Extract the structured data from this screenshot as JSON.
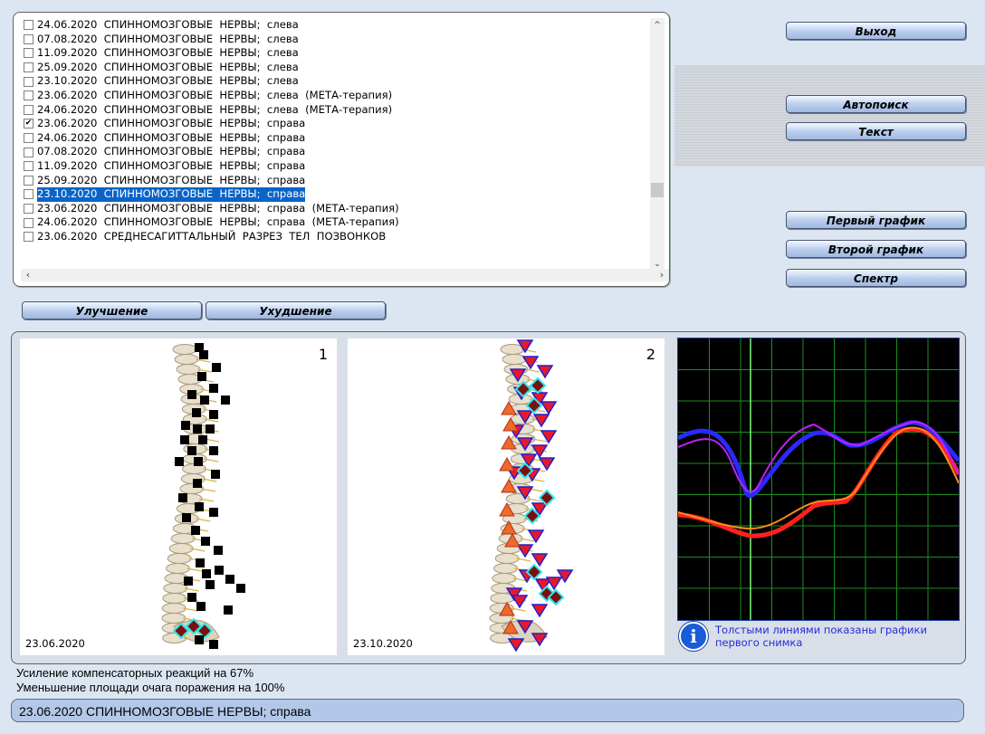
{
  "records": [
    {
      "checked": false,
      "text": "24.06.2020  СПИННОМОЗГОВЫЕ  НЕРВЫ;  слева"
    },
    {
      "checked": false,
      "text": "07.08.2020  СПИННОМОЗГОВЫЕ  НЕРВЫ;  слева"
    },
    {
      "checked": false,
      "text": "11.09.2020  СПИННОМОЗГОВЫЕ  НЕРВЫ;  слева"
    },
    {
      "checked": false,
      "text": "25.09.2020  СПИННОМОЗГОВЫЕ  НЕРВЫ;  слева"
    },
    {
      "checked": false,
      "text": "23.10.2020  СПИННОМОЗГОВЫЕ  НЕРВЫ;  слева"
    },
    {
      "checked": false,
      "text": "23.06.2020  СПИННОМОЗГОВЫЕ  НЕРВЫ;  слева  (МЕТА-терапия)"
    },
    {
      "checked": false,
      "text": "24.06.2020  СПИННОМОЗГОВЫЕ  НЕРВЫ;  слева  (МЕТА-терапия)"
    },
    {
      "checked": true,
      "text": "23.06.2020  СПИННОМОЗГОВЫЕ  НЕРВЫ;  справа"
    },
    {
      "checked": false,
      "text": "24.06.2020  СПИННОМОЗГОВЫЕ  НЕРВЫ;  справа"
    },
    {
      "checked": false,
      "text": "07.08.2020  СПИННОМОЗГОВЫЕ  НЕРВЫ;  справа"
    },
    {
      "checked": false,
      "text": "11.09.2020  СПИННОМОЗГОВЫЕ  НЕРВЫ;  справа"
    },
    {
      "checked": false,
      "text": "25.09.2020  СПИННОМОЗГОВЫЕ  НЕРВЫ;  справа"
    },
    {
      "checked": false,
      "text": "23.10.2020  СПИННОМОЗГОВЫЕ  НЕРВЫ;  справа",
      "selected": true
    },
    {
      "checked": false,
      "text": "23.06.2020  СПИННОМОЗГОВЫЕ  НЕРВЫ;  справа  (МЕТА-терапия)"
    },
    {
      "checked": false,
      "text": "24.06.2020  СПИННОМОЗГОВЫЕ  НЕРВЫ;  справа  (МЕТА-терапия)"
    },
    {
      "checked": false,
      "text": "23.06.2020  СРЕДНЕСАГИТТАЛЬНЫЙ  РАЗРЕЗ  ТЕЛ  ПОЗВОНКОВ"
    }
  ],
  "buttons": {
    "exit": "Выход",
    "autosearch": "Автопоиск",
    "text": "Текст",
    "first_graph": "Первый график",
    "second_graph": "Второй график",
    "spectrum": "Спектр",
    "improvement": "Улучшение",
    "deterioration": "Ухудшение"
  },
  "images": [
    {
      "number": "1",
      "date": "23.06.2020"
    },
    {
      "number": "2",
      "date": "23.10.2020"
    }
  ],
  "info_text": "Толстыми линиями показаны графики первого снимка",
  "status_lines": [
    "Усиление компенсаторных реакций на 67%",
    "Уменьшение площади очага поражения на 100%"
  ],
  "bottom_bar": "23.06.2020 СПИННОМОЗГОВЫЕ  НЕРВЫ;  справа",
  "colors": {
    "selection": "#0a64c8",
    "graph_background": "#000000",
    "grid": "#1c8f1c",
    "cursor_line": "#7cff7c"
  },
  "icons": [
    "checkbox",
    "scroll-up-icon",
    "scroll-down-icon",
    "scroll-left-icon",
    "scroll-right-icon",
    "info-icon",
    "marker-square",
    "marker-triangle-down",
    "marker-triangle-up",
    "marker-diamond"
  ]
}
